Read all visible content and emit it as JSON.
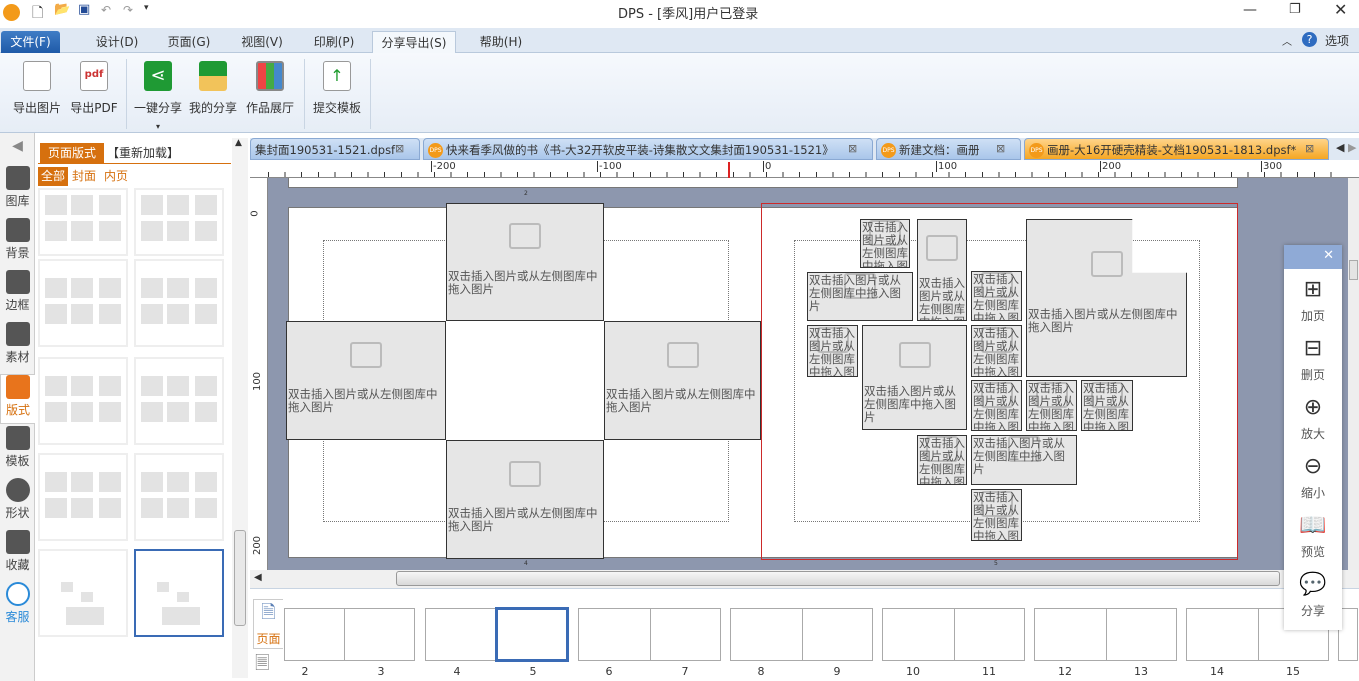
{
  "window": {
    "title": "DPS - [季风]用户已登录",
    "app_icon": "DPS"
  },
  "menu": {
    "items": [
      "文件(F)",
      "设计(D)",
      "页面(G)",
      "视图(V)",
      "印刷(P)",
      "分享导出(S)",
      "帮助(H)"
    ],
    "active": "分享导出(S)",
    "options": "选项"
  },
  "ribbon": {
    "buttons": [
      "导出图片",
      "导出PDF",
      "一键分享",
      "我的分享",
      "作品展厅",
      "提交模板"
    ]
  },
  "left_tools": [
    "图库",
    "背景",
    "边框",
    "素材",
    "版式",
    "模板",
    "形状",
    "收藏",
    "客服"
  ],
  "panel": {
    "tab": "页面版式",
    "reload": "【重新加载】",
    "filters": [
      "全部",
      "封面",
      "内页"
    ],
    "active_filter": "全部"
  },
  "doc_tabs": [
    {
      "label": "集封面190531-1521.dpsf",
      "active": false
    },
    {
      "label": "快来看季风做的书《书-大32开软皮平装-诗集散文文集封面190531-1521》",
      "active": false
    },
    {
      "label": "新建文档：画册",
      "active": false
    },
    {
      "label": "画册-大16开硬壳精装-文档190531-1813.dpsf*",
      "active": true
    }
  ],
  "ruler": {
    "h_labels": [
      "-200",
      "-100",
      "0",
      "100",
      "200",
      "300"
    ],
    "v_labels": [
      "0",
      "100",
      "200"
    ]
  },
  "placeholder_text": "双击插入图片或从左侧图库中拖入图片",
  "page_markers": [
    "2",
    "4",
    "5"
  ],
  "float_panel": [
    "加页",
    "删页",
    "放大",
    "缩小",
    "预览",
    "分享"
  ],
  "bottom": {
    "tab": "页面",
    "page_numbers": [
      "2",
      "3",
      "4",
      "5",
      "6",
      "7",
      "8",
      "9",
      "10",
      "11",
      "12",
      "13",
      "14",
      "15"
    ],
    "selected_page": "5"
  },
  "colors": {
    "accent": "#d6700e",
    "selection": "#3a6bb5",
    "page_border": "#cc2a2a"
  }
}
